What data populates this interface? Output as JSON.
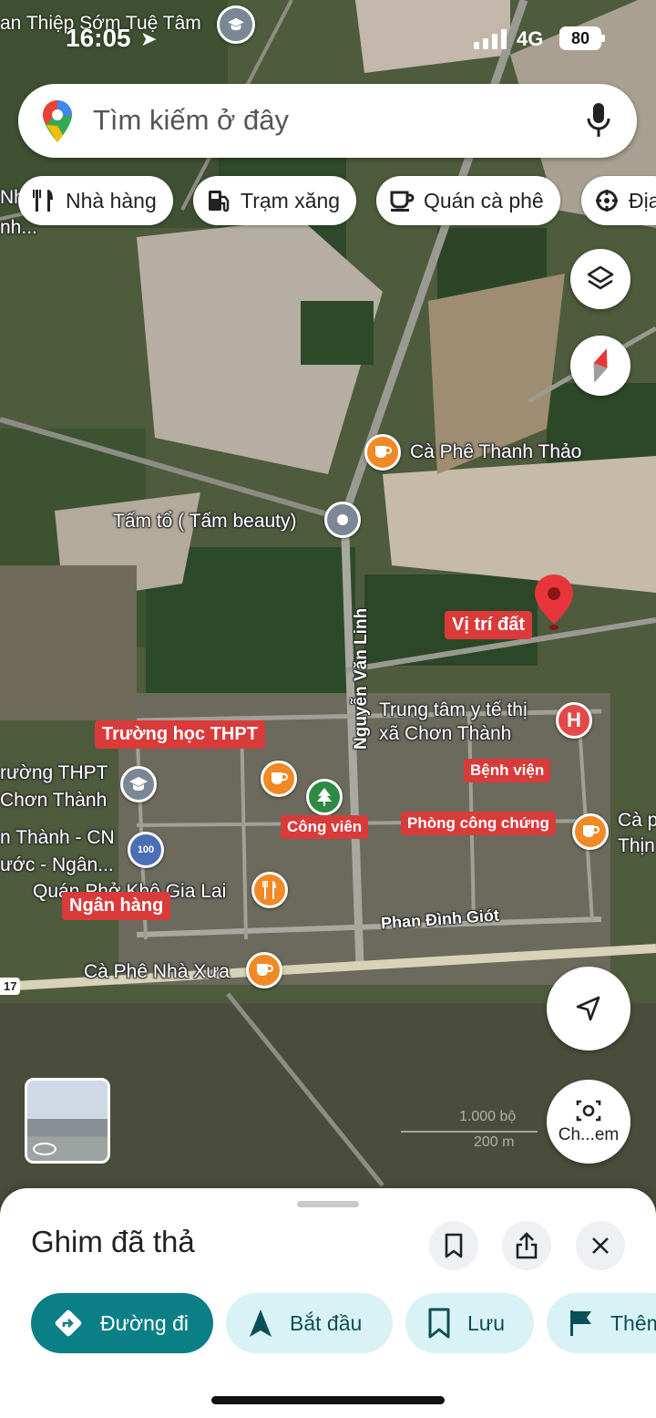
{
  "status_bar": {
    "time": "16:05",
    "carrier_overlay": "an Thiệp Sớm Tuệ Tâm",
    "network": "4G",
    "battery": "80"
  },
  "search": {
    "placeholder": "Tìm kiếm ở đây"
  },
  "chips": [
    {
      "label": "Nhà hàng",
      "icon": "fork-knife-icon"
    },
    {
      "label": "Trạm xăng",
      "icon": "gas-station-icon"
    },
    {
      "label": "Quán cà phê",
      "icon": "coffee-cup-icon"
    },
    {
      "label": "Địa",
      "icon": "attractions-icon"
    }
  ],
  "map": {
    "labels": {
      "nh_fragment": "Nh",
      "nh_fragment2": "nh...",
      "cafe_thanh_thao": "Cà Phê Thanh Thảo",
      "tam_beauty": "Tấm tổ ( Tấm beauty)",
      "road_nguyen_van_linh": "Nguyễn Văn Linh",
      "medical_center": "Trung tâm y tế thị\nxã Chơn Thành",
      "school_fragment": "rường THPT\nChơn Thành",
      "bank_fragment": "n Thành - CN\nước - Ngân...",
      "restaurant_fragment": "Quán Phở Khô Gia Lai",
      "road_phan_dinh_giot": "Phan Đình Giót",
      "cafe_nha_xua": "Cà Phê Nhà Xưa",
      "cafe_right_fragment": "Cà p\nThịn",
      "highway_shield": "17",
      "scale_ft": "1.000 bộ",
      "scale_m": "200 m"
    },
    "tags": {
      "land_location": "Vị trí đất",
      "high_school": "Trường học THPT",
      "hospital": "Bệnh viện",
      "park": "Công viên",
      "notary": "Phòng công chứng",
      "bank": "Ngân hàng"
    },
    "buttons": {
      "layers": "layers-icon",
      "compass": "compass-icon",
      "my_location": "navigation-arrow-icon",
      "camera_label": "Ch...em"
    }
  },
  "sheet": {
    "title": "Ghim đã thả",
    "actions": {
      "directions": "Đường đi",
      "start": "Bắt đầu",
      "save": "Lưu",
      "more": "Thêm"
    }
  },
  "colors": {
    "primary_action": "#0b7f86",
    "secondary_action": "#d9f2f5",
    "tag_red": "#d93b3b",
    "poi_orange": "#f08a24"
  }
}
